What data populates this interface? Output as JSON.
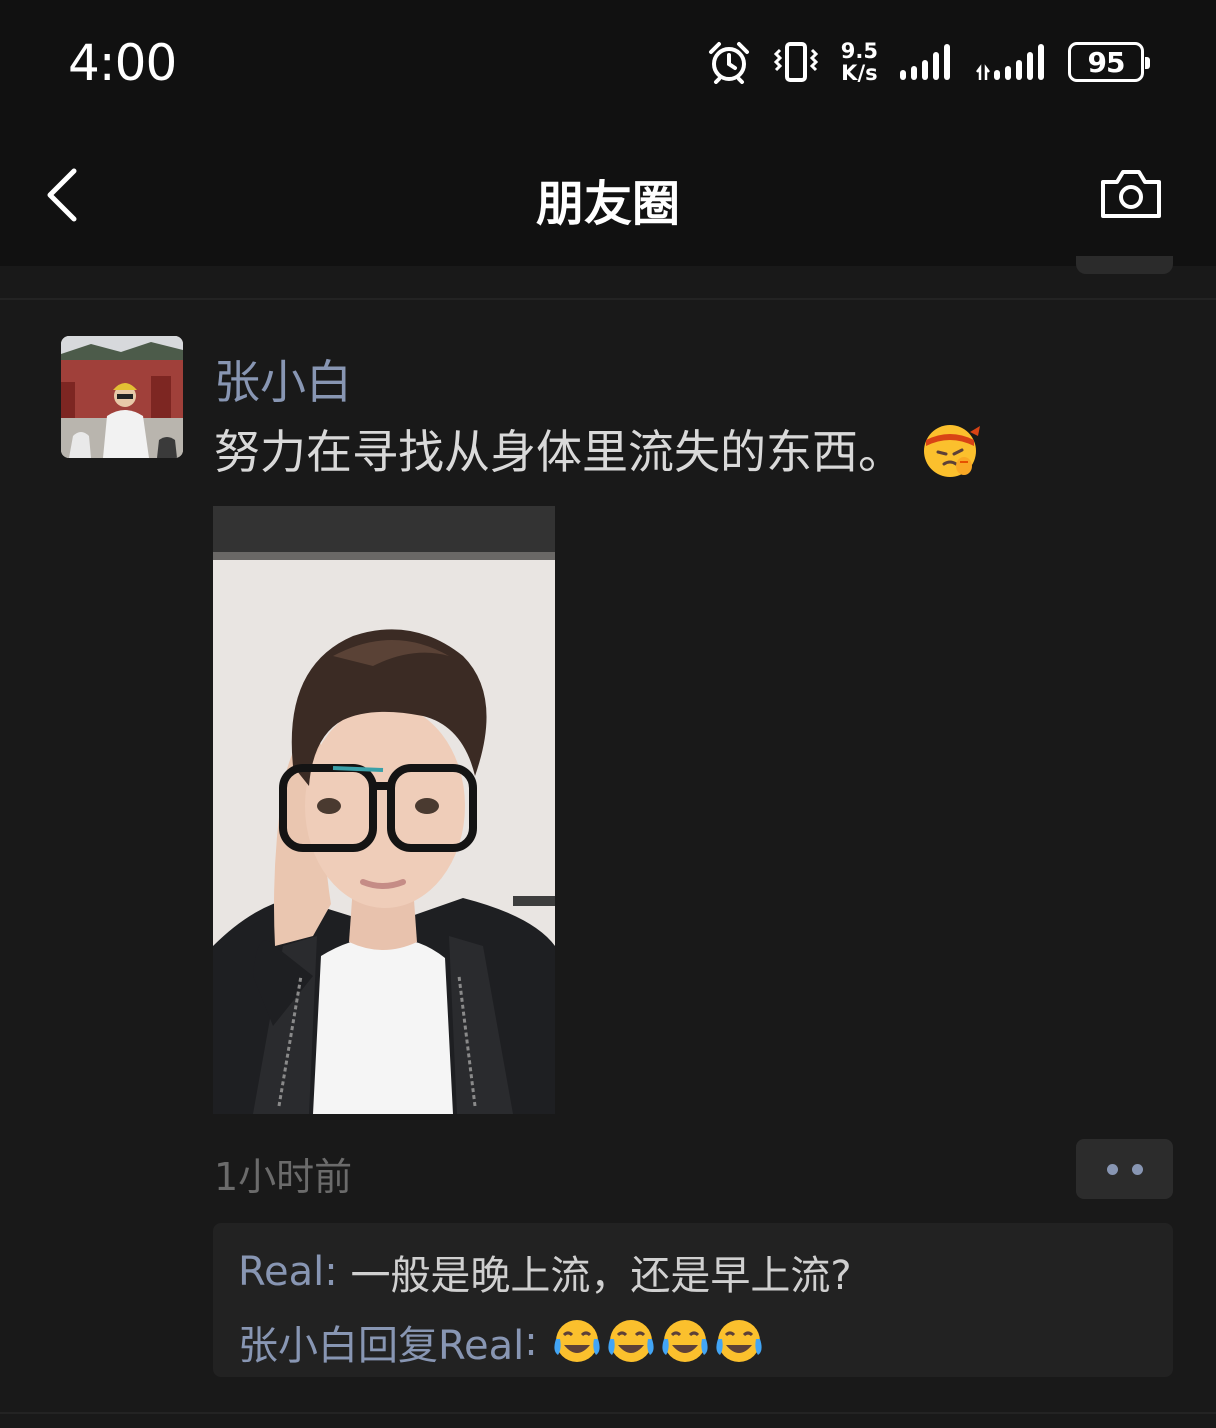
{
  "status_bar": {
    "time": "4:00",
    "net_speed_value": "9.5",
    "net_speed_unit": "K/s",
    "battery": "95",
    "icons": [
      "alarm-icon",
      "vibrate-icon",
      "signal-icon",
      "signal-icon"
    ]
  },
  "nav": {
    "title": "朋友圈",
    "back_icon": "chevron-left-icon",
    "camera_icon": "camera-icon"
  },
  "post": {
    "author": "张小白",
    "text": "努力在寻找从身体里流失的东西。",
    "emoji": "thinking-headband-face-emoji",
    "time": "1小时前",
    "comments": [
      {
        "author": "Real",
        "separator": ": ",
        "text": "一般是晚上流，还是早上流?"
      },
      {
        "author": "张小白回复Real",
        "separator": ": ",
        "text": "",
        "emojis": 4
      }
    ]
  },
  "colors": {
    "background": "#191919",
    "bar": "#111111",
    "link": "#8896b3",
    "comment_bg": "#222222"
  }
}
